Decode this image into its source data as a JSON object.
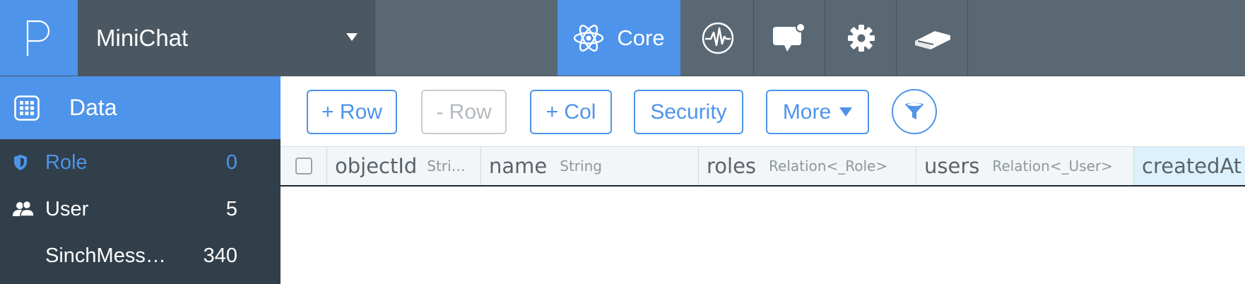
{
  "app": {
    "name": "MiniChat"
  },
  "nav": {
    "tabs": [
      {
        "label": "Core",
        "icon": "atom-icon",
        "active": true
      },
      {
        "label": "",
        "icon": "analytics-pulse-icon"
      },
      {
        "label": "",
        "icon": "push-notification-icon"
      },
      {
        "label": "",
        "icon": "gear-icon"
      },
      {
        "label": "",
        "icon": "docs-book-icon"
      }
    ]
  },
  "sidebar": {
    "section": {
      "label": "Data",
      "icon": "grid-icon"
    },
    "classes": [
      {
        "name": "Role",
        "count": "0",
        "icon": "shield-icon",
        "selected": true
      },
      {
        "name": "User",
        "count": "5",
        "icon": "users-icon"
      },
      {
        "name": "SinchMess…",
        "count": "340"
      }
    ]
  },
  "toolbar": {
    "add_row": "+ Row",
    "remove_row": "- Row",
    "add_col": "+ Col",
    "security": "Security",
    "more": "More"
  },
  "grid": {
    "columns": [
      {
        "name": "objectId",
        "type": "Stri…"
      },
      {
        "name": "name",
        "type": "String"
      },
      {
        "name": "roles",
        "type": "Relation<_Role>"
      },
      {
        "name": "users",
        "type": "Relation<_User>"
      },
      {
        "name": "createdAt",
        "type": ""
      }
    ],
    "rows": []
  },
  "colors": {
    "accent": "#4e94ea",
    "topbar": "#5a6873",
    "sidebar": "#313f4a",
    "highlight_col": "#dcf1fb"
  }
}
